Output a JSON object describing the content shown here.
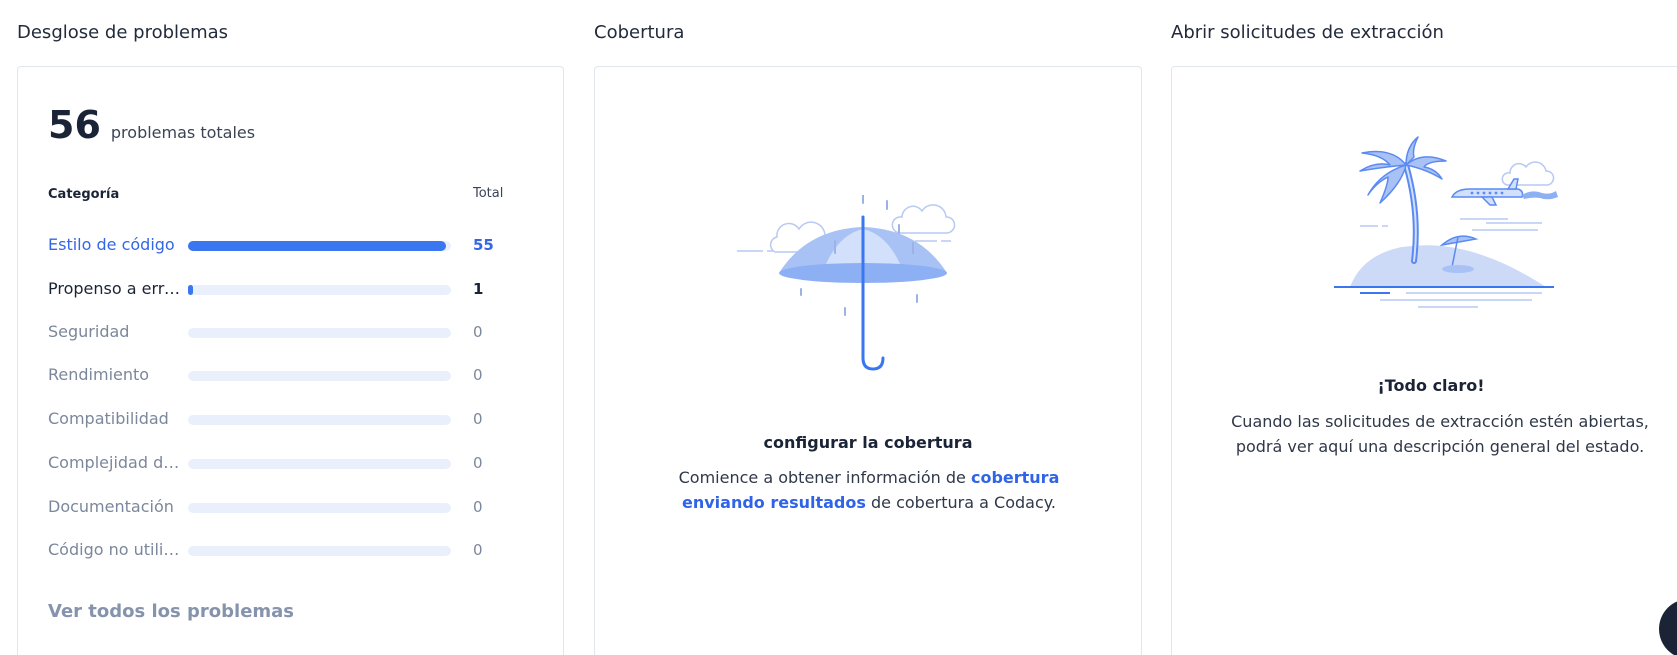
{
  "issues": {
    "title": "Desglose de problemas",
    "total": "56",
    "total_label": "problemas totales",
    "col_category": "Categoría",
    "col_total": "Total",
    "categories": [
      {
        "label": "Estilo de código",
        "value": "55",
        "fraction": 0.98
      },
      {
        "label": "Propenso a errores",
        "value": "1",
        "fraction": 0.02
      },
      {
        "label": "Seguridad",
        "value": "0",
        "fraction": 0
      },
      {
        "label": "Rendimiento",
        "value": "0",
        "fraction": 0
      },
      {
        "label": "Compatibilidad",
        "value": "0",
        "fraction": 0
      },
      {
        "label": "Complejidad del código",
        "value": "0",
        "fraction": 0
      },
      {
        "label": "Documentación",
        "value": "0",
        "fraction": 0
      },
      {
        "label": "Código no utilizado",
        "value": "0",
        "fraction": 0
      }
    ],
    "see_all": "Ver todos los problemas"
  },
  "coverage": {
    "title": "Cobertura",
    "empty_title": "configurar la cobertura",
    "text_before": "Comience a obtener información de ",
    "link": "cobertura enviando resultados",
    "text_after": " de cobertura a Codacy.",
    "illustration": "umbrella-illustration"
  },
  "pull_requests": {
    "title": "Abrir solicitudes de extracción",
    "empty_title": "¡Todo claro!",
    "text": "Cuando las solicitudes de extracción estén abiertas, podrá ver aquí una descripción general del estado.",
    "illustration": "island-illustration"
  },
  "colors": {
    "accent": "#3a76f0",
    "track": "#eaf0fb",
    "muted": "#7b879b"
  }
}
